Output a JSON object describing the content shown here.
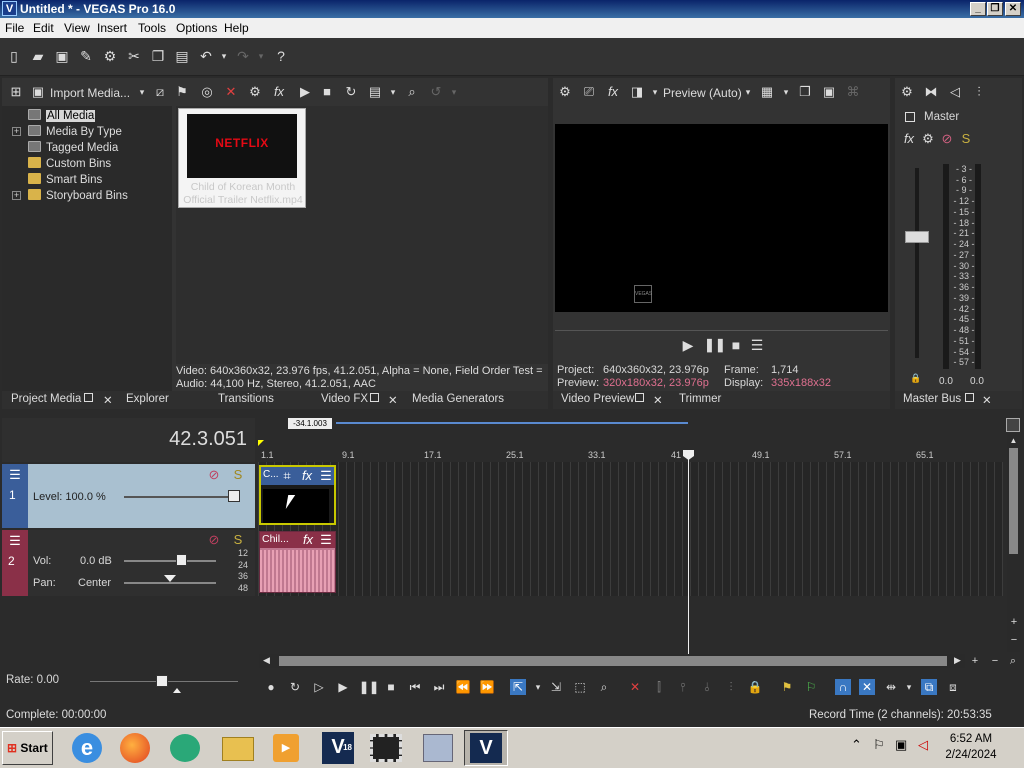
{
  "window": {
    "title": "Untitled * - VEGAS Pro 16.0",
    "logo": "V",
    "buttons": [
      "_",
      "❐",
      "✕"
    ]
  },
  "menu": [
    "File",
    "Edit",
    "View",
    "Insert",
    "Tools",
    "Options",
    "Help"
  ],
  "project_media": {
    "import_label": "Import Media...",
    "tree": [
      "All Media",
      "Media By Type",
      "Tagged Media",
      "Custom Bins",
      "Smart Bins",
      "Storyboard Bins"
    ],
    "thumb_brand": "NETFLIX",
    "thumb_caption": "Child of Korean Month Official Trailer Netflix.mp4",
    "info_video": "Video: 640x360x32, 23.976 fps, 41.2.051, Alpha = None, Field Order Test =",
    "info_audio": "Audio: 44,100 Hz, Stereo, 41.2.051, AAC"
  },
  "left_tabs": [
    "Project Media",
    "Explorer",
    "Transitions",
    "Video FX",
    "Media Generators"
  ],
  "preview": {
    "mode": "Preview (Auto)",
    "watermark": "VEGAS",
    "project_label": "Project:",
    "project_value": "640x360x32, 23.976p",
    "frame_label": "Frame:",
    "frame_value": "1,714",
    "preview_label": "Preview:",
    "preview_value": "320x180x32, 23.976p",
    "display_label": "Display:",
    "display_value": "335x188x32",
    "tabs": [
      "Video Preview",
      "Trimmer"
    ]
  },
  "master": {
    "label": "Master",
    "scale": [
      "3",
      "6",
      "9",
      "12",
      "15",
      "18",
      "21",
      "24",
      "27",
      "30",
      "33",
      "36",
      "39",
      "42",
      "45",
      "48",
      "51",
      "54",
      "57"
    ],
    "left_value": "0.0",
    "right_value": "0.0",
    "tab": "Master Bus"
  },
  "timeline": {
    "timecode": "42.3.051",
    "cursor_flag": "-34.1.003",
    "ruler": [
      "1.1",
      "9.1",
      "17.1",
      "25.1",
      "33.1",
      "41",
      "49.1",
      "57.1",
      "65.1"
    ],
    "video_track": {
      "number": "1",
      "level_label": "Level: 100.0 %",
      "level_fraction": 1.0,
      "clip_label": "C..."
    },
    "audio_track": {
      "number": "2",
      "vol_label": "Vol:",
      "vol_value": "0.0 dB",
      "pan_label": "Pan:",
      "pan_value": "Center",
      "clip_label": "Chil...",
      "scale": [
        "12",
        "24",
        "36",
        "48"
      ]
    },
    "rate": "Rate: 0.00"
  },
  "status": {
    "left": "Complete: 00:00:00",
    "right": "Record Time (2 channels): 20:53:35"
  },
  "taskbar": {
    "start": "Start",
    "time": "6:52 AM",
    "date": "2/24/2024",
    "v18": "V",
    "v18_sub": "18",
    "v": "V"
  },
  "colors": {
    "accent_blue": "#3a78c2",
    "clip_yellow": "#c8c800",
    "audio_pink": "#c07890",
    "pink_text": "#e07090"
  }
}
